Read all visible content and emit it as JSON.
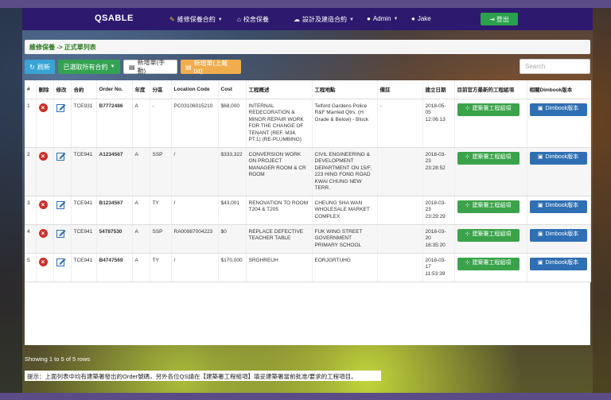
{
  "navbar": {
    "brand": "QSABLE",
    "items": [
      {
        "label": "維修保養合約",
        "icon": "wrench-icon"
      },
      {
        "label": "校舍保養",
        "icon": "building-icon"
      },
      {
        "label": "設計及建造合約",
        "icon": "cloud-icon"
      },
      {
        "label": "Admin",
        "icon": "user-icon"
      },
      {
        "label": "Jake",
        "icon": "user-icon"
      }
    ],
    "logout_label": "登出"
  },
  "breadcrumb": "維修保養 -> 正式單列表",
  "toolbar": {
    "refresh_label": "刷新",
    "cancel_label": "已選取所有合約",
    "new_manual_label": "新增單(手動)",
    "new_upload_label": "新增單(上載txt)",
    "search_placeholder": "Search"
  },
  "table": {
    "headers": [
      "#",
      "刪除",
      "修改",
      "合約",
      "Order No.",
      "年度",
      "分區",
      "Location Code",
      "Cost",
      "工程概述",
      "工程地點",
      "備註",
      "建立日期",
      "目前官方最新的工程組項",
      "相關Dimbook版本"
    ],
    "rows": [
      {
        "num": "1",
        "contract": "TCE931",
        "order": "B7772486",
        "year": "A",
        "district": "-",
        "location_code": "PC03106015210",
        "cost": "$68,000",
        "desc": "INTERNAL REDECORATION & MINOR REPAIR WORK FOR THE CHANGE OF TENANT (REF. M34, PT.1) (RE-PLUMBING)",
        "site": "Telford Gardens Police R&F Married Qtrs. (H Grade & Below) - Block",
        "remark": "-",
        "date": "2018-05-05 12:06:13"
      },
      {
        "num": "2",
        "contract": "TCE941",
        "order": "A1234567",
        "year": "A",
        "district": "SSP",
        "location_code": "/",
        "cost": "$333,322",
        "desc": "CONVERSION WORK ON PROJECT MANAGER ROOM & CR ROOM",
        "site": "CIVIL ENGINEERING & DEVELOPMENT DEPARTMENT ON 15/F, 223 HING FONG ROAD KWAI CHUNG NEW TERR.",
        "remark": "",
        "date": "2018-03-23 23:28:52"
      },
      {
        "num": "3",
        "contract": "TCE941",
        "order": "B1234567",
        "year": "A",
        "district": "TY",
        "location_code": "/",
        "cost": "$43,001",
        "desc": "RENOVATION TO ROOM T204 & T205",
        "site": "CHEUNG SHA WAN WHOLESALE MARKET COMPLEX",
        "remark": "",
        "date": "2018-03-23 23:29:29"
      },
      {
        "num": "4",
        "contract": "TCE941",
        "order": "54787530",
        "year": "A",
        "district": "SSP",
        "location_code": "RA00987004223",
        "cost": "$0",
        "desc": "REPLACE DEFECTIVE TEACHER TABLE",
        "site": "FUK WING STREET GOVERNMENT PRIMARY SCHOOL",
        "remark": "",
        "date": "2018-03-20 16:35:20"
      },
      {
        "num": "5",
        "contract": "TCE941",
        "order": "B4747569",
        "year": "A",
        "district": "TY",
        "location_code": "/",
        "cost": "$170,000",
        "desc": "SRGHREUH",
        "site": "EORJGRTUHG",
        "remark": "",
        "date": "2018-03-17 11:53:39"
      }
    ],
    "works_btn_label": "建築署工程組項",
    "dimbook_btn_label": "Dimbook版本"
  },
  "footer": {
    "rows_info": "Showing 1 to 5 of 5 rows",
    "hint": "提示：上面列表中均有建築署發出的Order號碼，另外各位QS請在【建築署工程組項】填妥建築署當前批准/要求的工程項目。"
  }
}
